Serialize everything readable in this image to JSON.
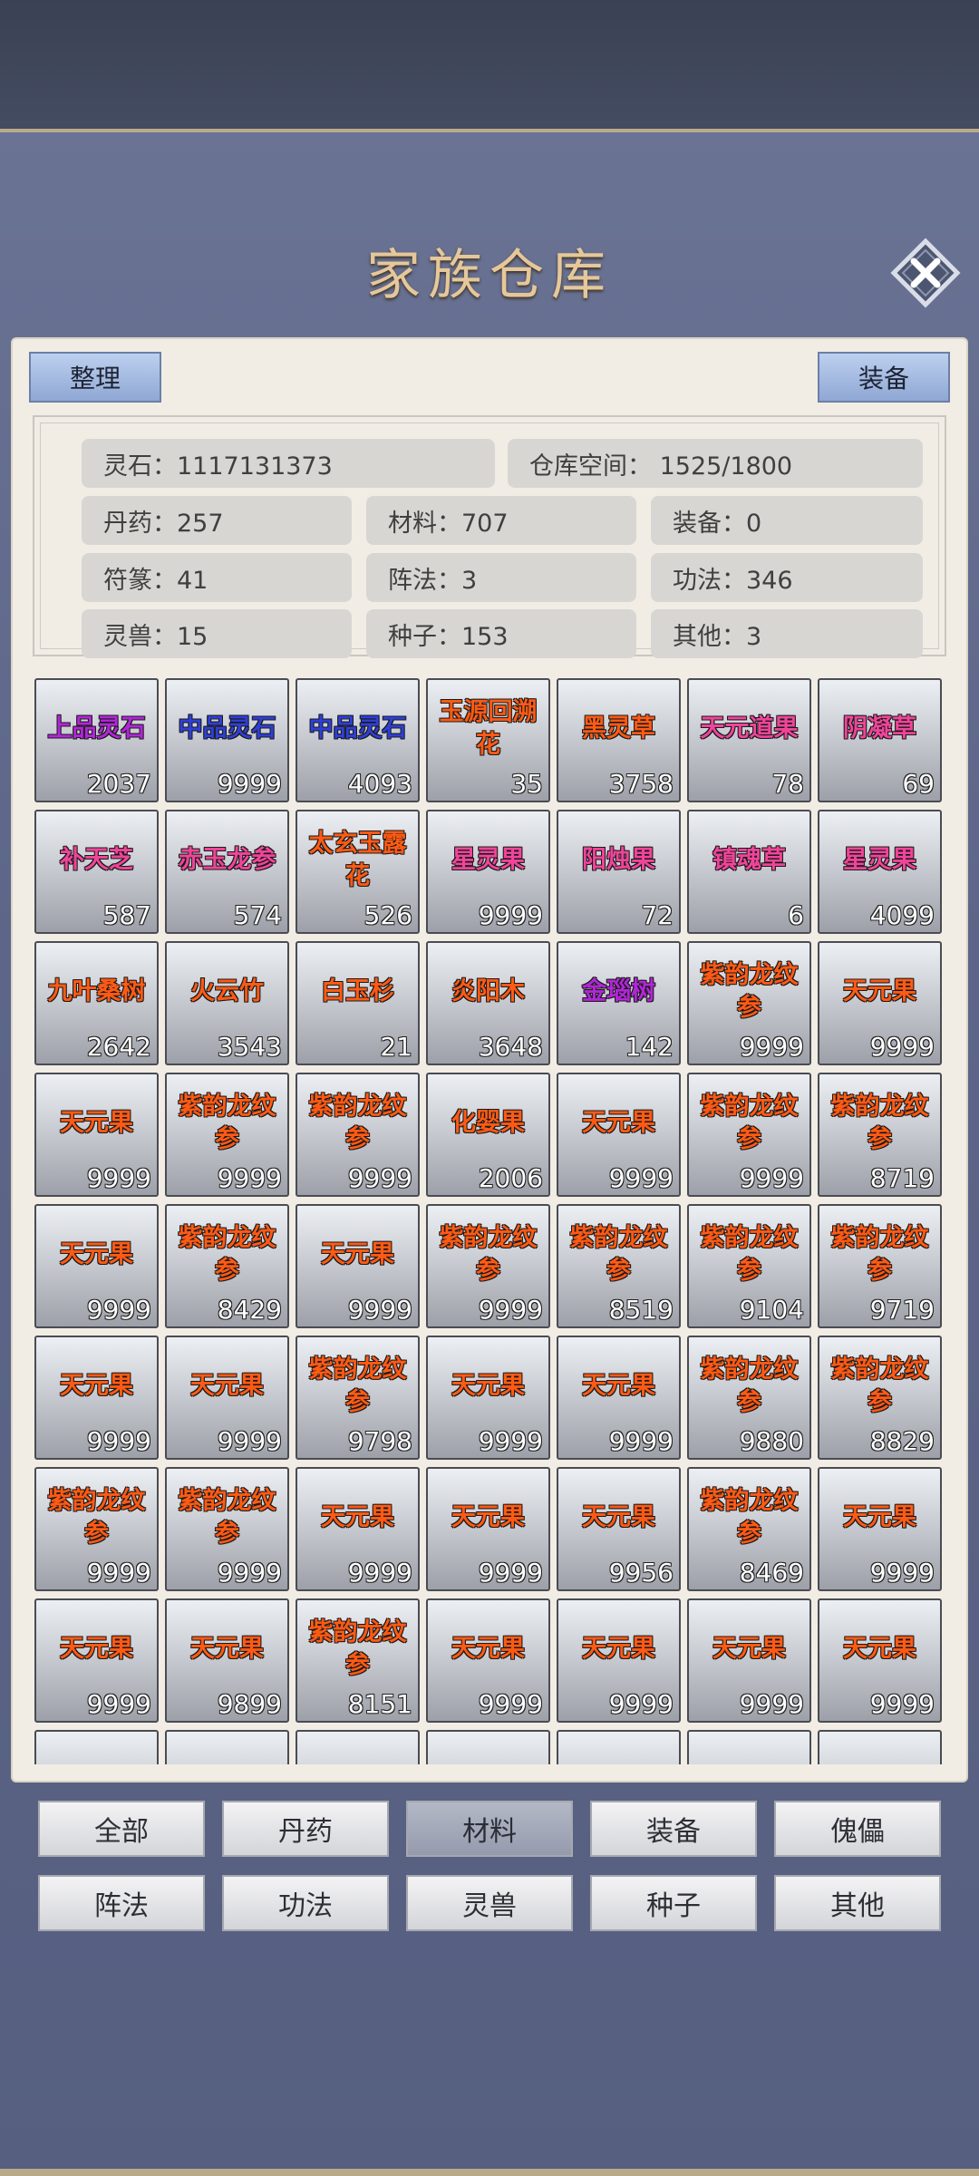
{
  "title": "家族仓库",
  "toolbar": {
    "sort_label": "整理",
    "equip_label": "装备"
  },
  "stats": {
    "spirit_stone": "灵石：1117131373",
    "storage": "仓库空间：  1525/1800",
    "pills": "丹药：257",
    "materials": "材料：707",
    "equipment": "装备：0",
    "talismans": "符篆：41",
    "formations": "阵法：3",
    "techniques": "功法：346",
    "beasts": "灵兽：15",
    "seeds": "种子：153",
    "other": "其他：3"
  },
  "colors": {
    "blue": "#2f3fd6",
    "purple": "#b226d8",
    "magenta": "#f0449a",
    "orange": "#ff5a14"
  },
  "items": [
    {
      "name": "上品灵石",
      "count": "2037",
      "color": "#b226d8"
    },
    {
      "name": "中品灵石",
      "count": "9999",
      "color": "#2f3fd6"
    },
    {
      "name": "中品灵石",
      "count": "4093",
      "color": "#2f3fd6"
    },
    {
      "name": "玉源回溯花",
      "count": "35",
      "color": "#ff5a14"
    },
    {
      "name": "黑灵草",
      "count": "3758",
      "color": "#ff5a14"
    },
    {
      "name": "天元道果",
      "count": "78",
      "color": "#f0449a"
    },
    {
      "name": "阴凝草",
      "count": "69",
      "color": "#f0449a"
    },
    {
      "name": "补天芝",
      "count": "587",
      "color": "#f0449a"
    },
    {
      "name": "赤玉龙参",
      "count": "574",
      "color": "#f0449a"
    },
    {
      "name": "太玄玉露花",
      "count": "526",
      "color": "#ff5a14"
    },
    {
      "name": "星灵果",
      "count": "9999",
      "color": "#f0449a"
    },
    {
      "name": "阳烛果",
      "count": "72",
      "color": "#f0449a"
    },
    {
      "name": "镇魂草",
      "count": "6",
      "color": "#f0449a"
    },
    {
      "name": "星灵果",
      "count": "4099",
      "color": "#f0449a"
    },
    {
      "name": "九叶桑树",
      "count": "2642",
      "color": "#ff5a14"
    },
    {
      "name": "火云竹",
      "count": "3543",
      "color": "#ff5a14"
    },
    {
      "name": "白玉杉",
      "count": "21",
      "color": "#ff5a14"
    },
    {
      "name": "炎阳木",
      "count": "3648",
      "color": "#ff5a14"
    },
    {
      "name": "金瑙树",
      "count": "142",
      "color": "#b226d8"
    },
    {
      "name": "紫韵龙纹参",
      "count": "9999",
      "color": "#ff5a14"
    },
    {
      "name": "天元果",
      "count": "9999",
      "color": "#ff5a14"
    },
    {
      "name": "天元果",
      "count": "9999",
      "color": "#ff5a14"
    },
    {
      "name": "紫韵龙纹参",
      "count": "9999",
      "color": "#ff5a14"
    },
    {
      "name": "紫韵龙纹参",
      "count": "9999",
      "color": "#ff5a14"
    },
    {
      "name": "化婴果",
      "count": "2006",
      "color": "#ff5a14"
    },
    {
      "name": "天元果",
      "count": "9999",
      "color": "#ff5a14"
    },
    {
      "name": "紫韵龙纹参",
      "count": "9999",
      "color": "#ff5a14"
    },
    {
      "name": "紫韵龙纹参",
      "count": "8719",
      "color": "#ff5a14"
    },
    {
      "name": "天元果",
      "count": "9999",
      "color": "#ff5a14"
    },
    {
      "name": "紫韵龙纹参",
      "count": "8429",
      "color": "#ff5a14"
    },
    {
      "name": "天元果",
      "count": "9999",
      "color": "#ff5a14"
    },
    {
      "name": "紫韵龙纹参",
      "count": "9999",
      "color": "#ff5a14"
    },
    {
      "name": "紫韵龙纹参",
      "count": "8519",
      "color": "#ff5a14"
    },
    {
      "name": "紫韵龙纹参",
      "count": "9104",
      "color": "#ff5a14"
    },
    {
      "name": "紫韵龙纹参",
      "count": "9719",
      "color": "#ff5a14"
    },
    {
      "name": "天元果",
      "count": "9999",
      "color": "#ff5a14"
    },
    {
      "name": "天元果",
      "count": "9999",
      "color": "#ff5a14"
    },
    {
      "name": "紫韵龙纹参",
      "count": "9798",
      "color": "#ff5a14"
    },
    {
      "name": "天元果",
      "count": "9999",
      "color": "#ff5a14"
    },
    {
      "name": "天元果",
      "count": "9999",
      "color": "#ff5a14"
    },
    {
      "name": "紫韵龙纹参",
      "count": "9880",
      "color": "#ff5a14"
    },
    {
      "name": "紫韵龙纹参",
      "count": "8829",
      "color": "#ff5a14"
    },
    {
      "name": "紫韵龙纹参",
      "count": "9999",
      "color": "#ff5a14"
    },
    {
      "name": "紫韵龙纹参",
      "count": "9999",
      "color": "#ff5a14"
    },
    {
      "name": "天元果",
      "count": "9999",
      "color": "#ff5a14"
    },
    {
      "name": "天元果",
      "count": "9999",
      "color": "#ff5a14"
    },
    {
      "name": "天元果",
      "count": "9956",
      "color": "#ff5a14"
    },
    {
      "name": "紫韵龙纹参",
      "count": "8469",
      "color": "#ff5a14"
    },
    {
      "name": "天元果",
      "count": "9999",
      "color": "#ff5a14"
    },
    {
      "name": "天元果",
      "count": "9999",
      "color": "#ff5a14"
    },
    {
      "name": "天元果",
      "count": "9899",
      "color": "#ff5a14"
    },
    {
      "name": "紫韵龙纹参",
      "count": "8151",
      "color": "#ff5a14"
    },
    {
      "name": "天元果",
      "count": "9999",
      "color": "#ff5a14"
    },
    {
      "name": "天元果",
      "count": "9999",
      "color": "#ff5a14"
    },
    {
      "name": "天元果",
      "count": "9999",
      "color": "#ff5a14"
    },
    {
      "name": "天元果",
      "count": "9999",
      "color": "#ff5a14"
    }
  ],
  "categories": [
    {
      "label": "全部",
      "active": false
    },
    {
      "label": "丹药",
      "active": false
    },
    {
      "label": "材料",
      "active": true
    },
    {
      "label": "装备",
      "active": false
    },
    {
      "label": "傀儡",
      "active": false
    },
    {
      "label": "阵法",
      "active": false
    },
    {
      "label": "功法",
      "active": false
    },
    {
      "label": "灵兽",
      "active": false
    },
    {
      "label": "种子",
      "active": false
    },
    {
      "label": "其他",
      "active": false
    }
  ]
}
